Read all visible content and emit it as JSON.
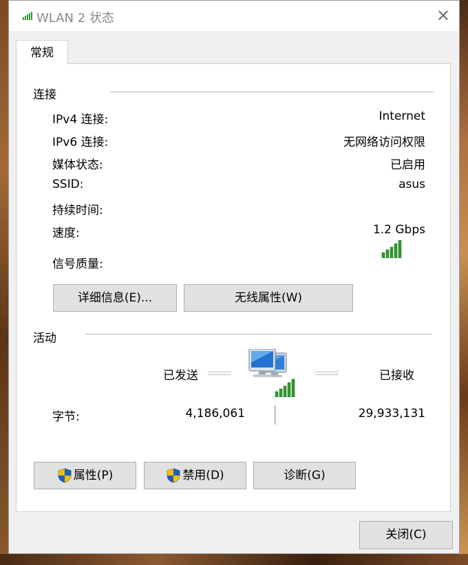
{
  "window": {
    "title": "WLAN 2 状态",
    "close_glyph": "✕"
  },
  "tabs": [
    {
      "label": "常规"
    }
  ],
  "connection": {
    "section_label": "连接",
    "rows": [
      {
        "label": "IPv4 连接:",
        "value": "Internet"
      },
      {
        "label": "IPv6 连接:",
        "value": "无网络访问权限"
      },
      {
        "label": "媒体状态:",
        "value": "已启用"
      },
      {
        "label": "SSID:",
        "value": "asus"
      },
      {
        "label": "持续时间:",
        "value": ""
      },
      {
        "label": "速度:",
        "value": "1.2 Gbps"
      },
      {
        "label": "信号质量:",
        "value": ""
      }
    ],
    "signal_bars": 5,
    "details_button": "详细信息(E)...",
    "wireless_button": "无线属性(W)"
  },
  "activity": {
    "section_label": "活动",
    "sent_label": "已发送",
    "received_label": "已接收",
    "bytes_label": "字节:",
    "bytes_sent": "4,186,061",
    "bytes_received": "29,933,131"
  },
  "actions": {
    "properties_button": "属性(P)",
    "disable_button": "禁用(D)",
    "diagnose_button": "诊断(G)",
    "close_button": "关闭(C)"
  },
  "colors": {
    "signal_green": "#2e9a2e",
    "shield_blue": "#1f5fbf",
    "shield_yellow": "#f2c200"
  }
}
